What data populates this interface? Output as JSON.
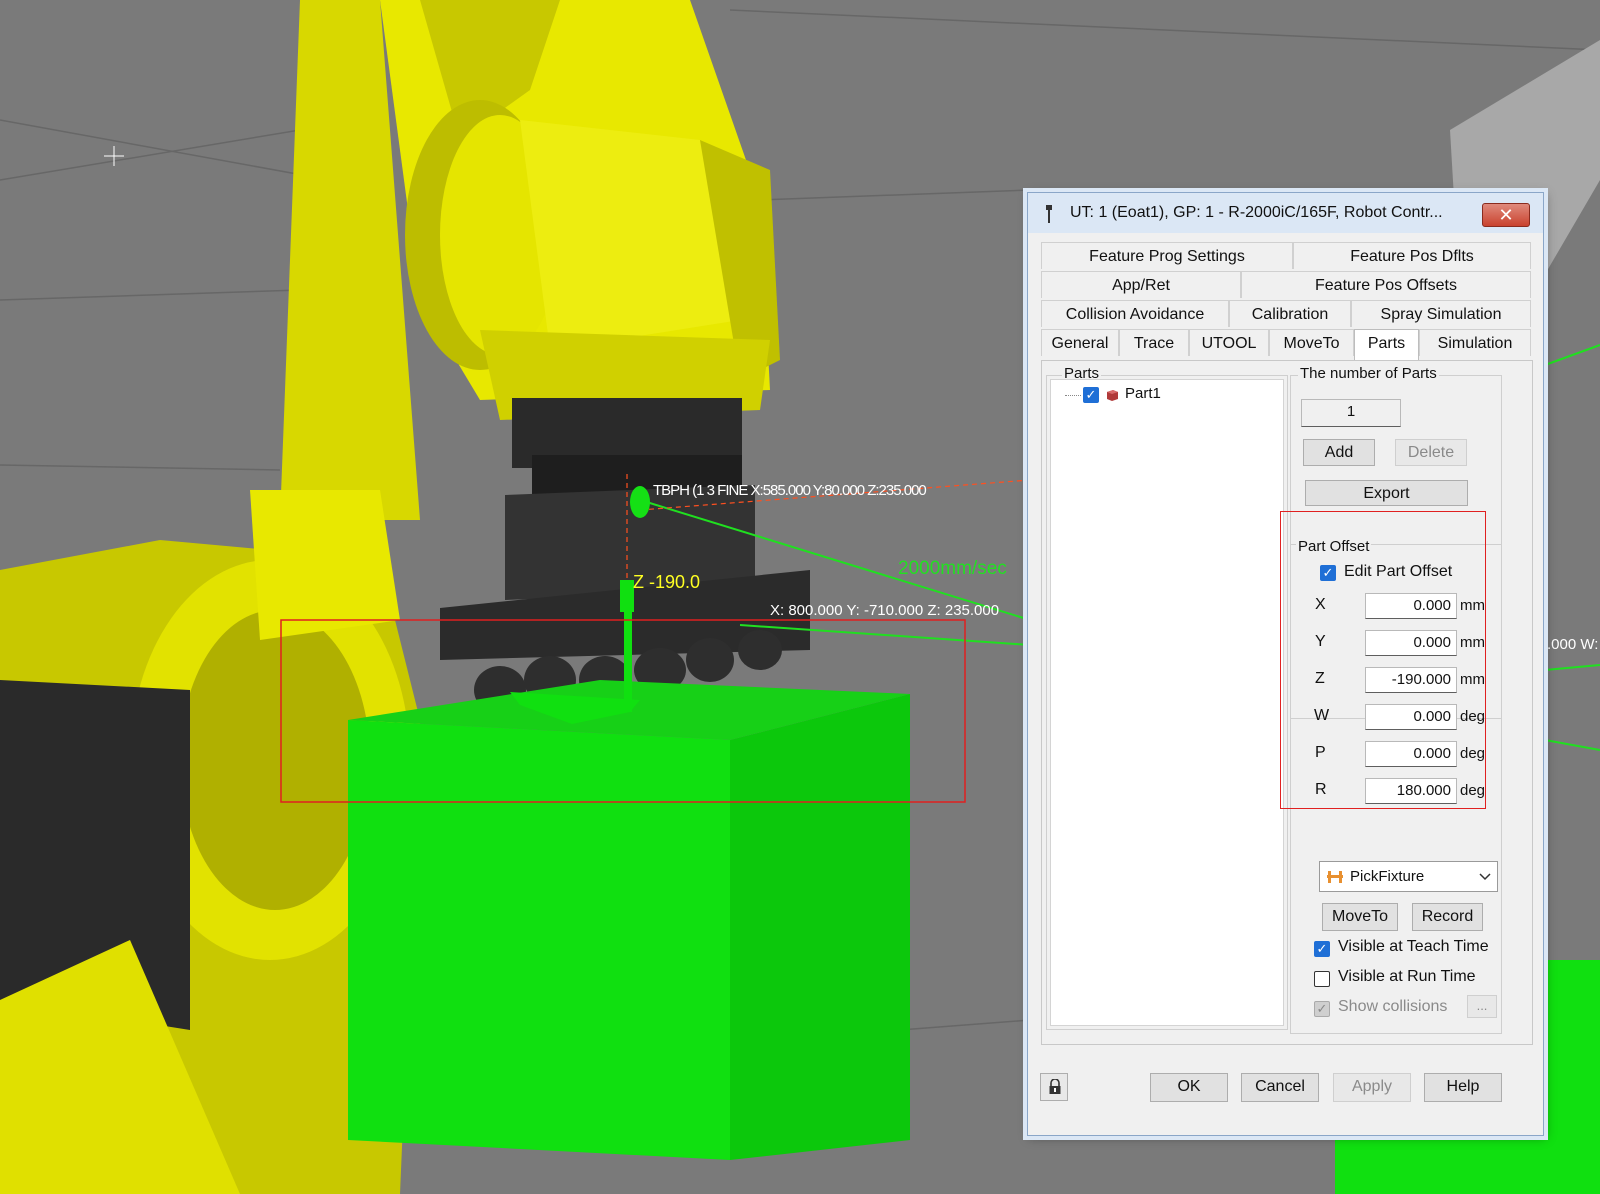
{
  "scene": {
    "speed_label": "2000mm/sec",
    "z_offset_label": "Z -190.0",
    "coordinate_label": "X: 800.000 Y: -710.000 Z: 235.000",
    "tool_frame_label": "TBPH (1 3 FINE X:585.000 Y:80.000 Z:235.000",
    "right_edge_label": ".000 W:"
  },
  "dialog": {
    "title": "UT: 1  (Eoat1), GP: 1 - R-2000iC/165F, Robot Contr...",
    "close_label": "✕",
    "tabs": {
      "row1": [
        "Feature Prog Settings",
        "Feature Pos Dflts"
      ],
      "row2": [
        "App/Ret",
        "Feature Pos Offsets"
      ],
      "row3": [
        "Collision Avoidance",
        "Calibration",
        "Spray Simulation"
      ],
      "row4": [
        "General",
        "Trace",
        "UTOOL",
        "MoveTo",
        "Parts",
        "Simulation"
      ],
      "active": "Parts"
    },
    "parts_group_label": "Parts",
    "parts_tree": [
      {
        "label": "Part1",
        "checked": true
      }
    ],
    "number_group_label": "The number of Parts",
    "number_of_parts": "1",
    "add_label": "Add",
    "delete_label": "Delete",
    "export_label": "Export",
    "part_offset": {
      "group_label": "Part Offset",
      "edit_checkbox_label": "Edit Part Offset",
      "edit_checked": true,
      "rows": [
        {
          "axis": "X",
          "value": "0.000",
          "unit": "mm"
        },
        {
          "axis": "Y",
          "value": "0.000",
          "unit": "mm"
        },
        {
          "axis": "Z",
          "value": "-190.000",
          "unit": "mm"
        },
        {
          "axis": "W",
          "value": "0.000",
          "unit": "deg"
        },
        {
          "axis": "P",
          "value": "0.000",
          "unit": "deg"
        },
        {
          "axis": "R",
          "value": "180.000",
          "unit": "deg"
        }
      ]
    },
    "fixture_select": {
      "value": "PickFixture"
    },
    "moveto_label": "MoveTo",
    "record_label": "Record",
    "visible_teach": {
      "label": "Visible at Teach Time",
      "checked": true
    },
    "visible_run": {
      "label": "Visible at Run Time",
      "checked": false
    },
    "show_collisions": {
      "label": "Show collisions",
      "checked": true,
      "enabled": false
    },
    "ellipsis_label": "...",
    "ok_label": "OK",
    "cancel_label": "Cancel",
    "apply_label": "Apply",
    "help_label": "Help"
  },
  "colors": {
    "robot_yellow": "#e8e800",
    "part_green": "#10e010",
    "background_gray": "#7a7a7a",
    "highlight_red": "#e02020"
  }
}
